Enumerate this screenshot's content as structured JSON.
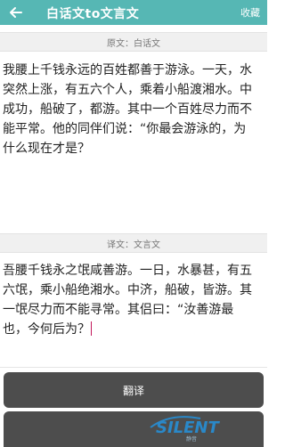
{
  "header": {
    "title": "白话文to文言文",
    "favorite_label": "收藏"
  },
  "source": {
    "heading": "原文：白话文",
    "text": "我腰上千钱永远的百姓都善于游泳。一天，水突然上涨，有五六个人，乘着小船渡湘水。中成功，船破了，都游。其中一个百姓尽力而不能平常。他的同伴们说：“你最会游泳的，为什么现在才是？"
  },
  "target": {
    "heading": "译文：文言文",
    "text": "吾腰千钱永之氓咸善游。一日，水暴甚，有五六氓，乘小船绝湘水。中济，船破，皆游。其一氓尽力而不能寻常。其侣曰：“汝善游最也，今何后为？"
  },
  "actions": {
    "translate_label": "翻译"
  },
  "watermark": {
    "text": "SILENT",
    "subtext": "静音"
  },
  "colors": {
    "topbar": "#56b7b4",
    "button": "#4d4d4d",
    "section": "#f0f0f0"
  }
}
